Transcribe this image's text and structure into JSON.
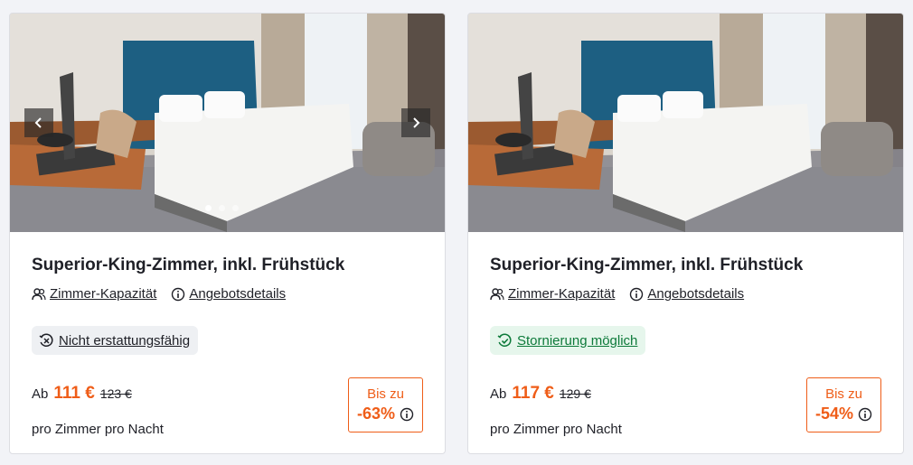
{
  "colors": {
    "accent": "#ef5d18",
    "success": "#0d7a3a",
    "success_bg": "#e6f6ec",
    "neutral_bg": "#eef0f3"
  },
  "cards": [
    {
      "title": "Superior-King-Zimmer, inkl. Frühstück",
      "capacity_label": "Zimmer-Kapazität",
      "details_label": "Angebotsdetails",
      "cancellation_label": "Nicht erstattungsfähig",
      "cancellation_icon": "no-refund-clock-icon",
      "from_label": "Ab",
      "price": "111 €",
      "old_price": "123 €",
      "per_label": "pro Zimmer pro Nacht",
      "discount_upto": "Bis zu",
      "discount": "-63%",
      "gallery_dots": 3,
      "gallery_active": 1
    },
    {
      "title": "Superior-King-Zimmer, inkl. Frühstück",
      "capacity_label": "Zimmer-Kapazität",
      "details_label": "Angebotsdetails",
      "cancellation_label": "Stornierung möglich",
      "cancellation_icon": "check-clock-icon",
      "from_label": "Ab",
      "price": "117 €",
      "old_price": "129 €",
      "per_label": "pro Zimmer pro Nacht",
      "discount_upto": "Bis zu",
      "discount": "-54%"
    }
  ]
}
